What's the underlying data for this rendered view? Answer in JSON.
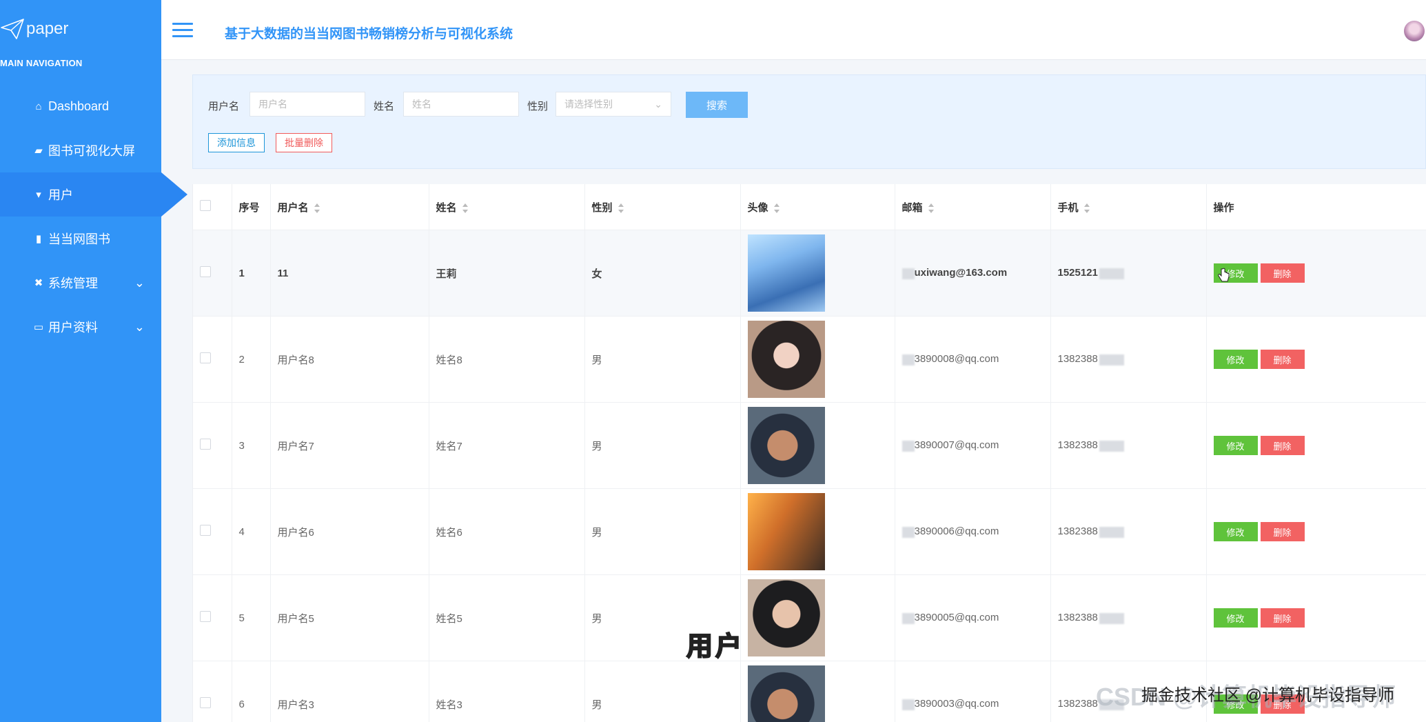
{
  "brand": {
    "name": "paper"
  },
  "sidebar": {
    "caption": "MAIN NAVIGATION",
    "items": [
      {
        "label": "Dashboard",
        "icon": "home-icon"
      },
      {
        "label": "图书可视化大屏",
        "icon": "screen-icon"
      },
      {
        "label": "用户",
        "icon": "user-icon",
        "active": true
      },
      {
        "label": "当当网图书",
        "icon": "bar-chart-icon"
      },
      {
        "label": "系统管理",
        "icon": "tools-icon",
        "expandable": true
      },
      {
        "label": "用户资料",
        "icon": "card-icon",
        "expandable": true
      }
    ]
  },
  "header": {
    "title": "基于大数据的当当网图书畅销榜分析与可视化系统"
  },
  "search": {
    "username_label": "用户名",
    "username_placeholder": "用户名",
    "name_label": "姓名",
    "name_placeholder": "姓名",
    "gender_label": "性别",
    "gender_placeholder": "请选择性别",
    "search_button": "搜索",
    "add_button": "添加信息",
    "batch_delete_button": "批量删除"
  },
  "table": {
    "columns": [
      "序号",
      "用户名",
      "姓名",
      "性别",
      "头像",
      "邮箱",
      "手机",
      "操作"
    ],
    "edit_label": "修改",
    "delete_label": "删除",
    "rows": [
      {
        "index": "1",
        "username": "11",
        "name": "王莉",
        "gender": "女",
        "email": "uxiwang@163.com",
        "phone": "1525121"
      },
      {
        "index": "2",
        "username": "用户名8",
        "name": "姓名8",
        "gender": "男",
        "email": "3890008@qq.com",
        "phone": "1382388"
      },
      {
        "index": "3",
        "username": "用户名7",
        "name": "姓名7",
        "gender": "男",
        "email": "3890007@qq.com",
        "phone": "1382388"
      },
      {
        "index": "4",
        "username": "用户名6",
        "name": "姓名6",
        "gender": "男",
        "email": "3890006@qq.com",
        "phone": "1382388"
      },
      {
        "index": "5",
        "username": "用户名5",
        "name": "姓名5",
        "gender": "男",
        "email": "3890005@qq.com",
        "phone": "1382388"
      },
      {
        "index": "6",
        "username": "用户名3",
        "name": "姓名3",
        "gender": "男",
        "email": "3890003@qq.com",
        "phone": "1382388"
      }
    ]
  },
  "overlay": {
    "caption": "用户",
    "watermark": "CSDN @计算机毕设指导师",
    "watermark2": "掘金技术社区 @计算机毕设指导师"
  },
  "colors": {
    "sidebar": "#3194f7",
    "accent": "#3194f7",
    "edit": "#5fc33b",
    "delete": "#f26262"
  }
}
